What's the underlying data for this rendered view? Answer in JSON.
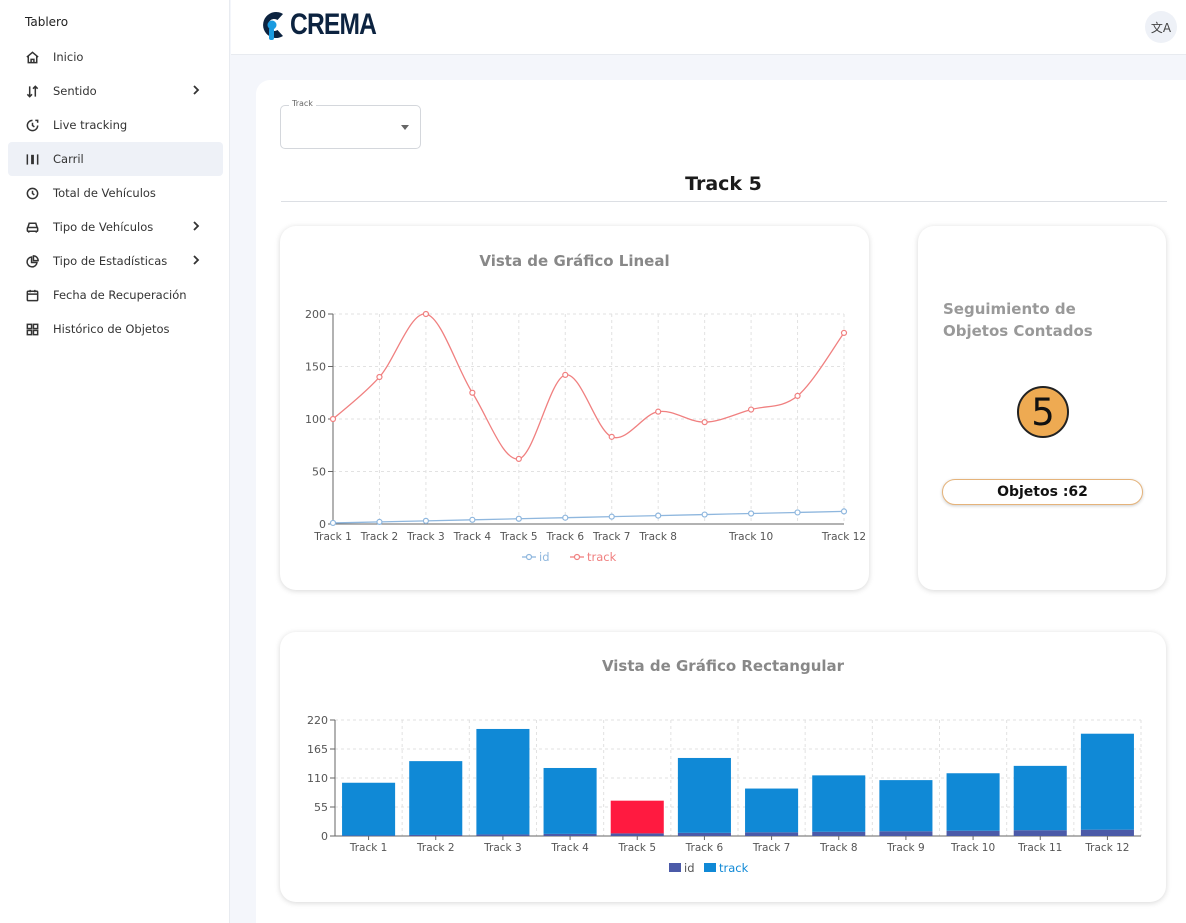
{
  "sidebar": {
    "heading": "Tablero",
    "items": [
      {
        "label": "Inicio",
        "icon": "home-icon",
        "chevron": false,
        "active": false
      },
      {
        "label": "Sentido",
        "icon": "sort-arrows-icon",
        "chevron": true,
        "active": false
      },
      {
        "label": "Live tracking",
        "icon": "live-clock-icon",
        "chevron": false,
        "active": false
      },
      {
        "label": "Carril",
        "icon": "lane-icon",
        "chevron": false,
        "active": true
      },
      {
        "label": "Total de Vehículos",
        "icon": "clock-icon",
        "chevron": false,
        "active": false
      },
      {
        "label": "Tipo de Vehículos",
        "icon": "car-icon",
        "chevron": true,
        "active": false
      },
      {
        "label": "Tipo de Estadísticas",
        "icon": "pie-chart-icon",
        "chevron": true,
        "active": false
      },
      {
        "label": "Fecha de Recuperación",
        "icon": "calendar-icon",
        "chevron": false,
        "active": false
      },
      {
        "label": "Histórico de Objetos",
        "icon": "grid-icon",
        "chevron": false,
        "active": false
      }
    ]
  },
  "header": {
    "logo_text": "CREMA",
    "translate_icon": "translate-icon",
    "translate_glyph": "文A"
  },
  "main": {
    "select_label": "Track",
    "select_value": "",
    "title": "Track 5",
    "count_card": {
      "title": "Seguimiento de Objetos Contados",
      "number": "5",
      "objects_label": "Objetos :62"
    }
  },
  "colors": {
    "line_id": "#8fb7de",
    "line_track": "#f08080",
    "bar_track": "#1089d6",
    "bar_highlight": "#ff1a40",
    "bar_id": "#4b5aa8",
    "badge": "#eeaa52"
  },
  "chart_data": [
    {
      "type": "line",
      "title": "Vista de Gráfico Lineal",
      "categories": [
        "Track 1",
        "Track 2",
        "Track 3",
        "Track 4",
        "Track 5",
        "Track 6",
        "Track 7",
        "Track 8",
        "Track 9",
        "Track 10",
        "Track 11",
        "Track 12"
      ],
      "tick_labels_shown": [
        "Track 1",
        "Track 2",
        "Track 3",
        "Track 4",
        "Track 5",
        "Track 6",
        "Track 7",
        "Track 8",
        "Track 10",
        "Track 12"
      ],
      "series": [
        {
          "name": "id",
          "values": [
            1,
            2,
            3,
            4,
            5,
            6,
            7,
            8,
            9,
            10,
            11,
            12
          ]
        },
        {
          "name": "track",
          "values": [
            100,
            140,
            200,
            125,
            62,
            142,
            83,
            107,
            97,
            109,
            122,
            182
          ]
        }
      ],
      "ylim": [
        0,
        200
      ],
      "yticks": [
        0,
        50,
        100,
        150,
        200
      ],
      "grid": true,
      "legend": "bottom"
    },
    {
      "type": "bar",
      "title": "Vista de Gráfico Rectangular",
      "categories": [
        "Track 1",
        "Track 2",
        "Track 3",
        "Track 4",
        "Track 5",
        "Track 6",
        "Track 7",
        "Track 8",
        "Track 9",
        "Track 10",
        "Track 11",
        "Track 12"
      ],
      "series": [
        {
          "name": "id",
          "values": [
            1,
            2,
            3,
            4,
            5,
            6,
            7,
            8,
            9,
            10,
            11,
            12
          ]
        },
        {
          "name": "track",
          "values": [
            100,
            140,
            200,
            125,
            62,
            142,
            83,
            107,
            97,
            109,
            122,
            182
          ]
        }
      ],
      "stacked": true,
      "highlight": "Track 5",
      "ylim": [
        0,
        220
      ],
      "yticks": [
        0,
        55,
        110,
        165,
        220
      ],
      "grid": true,
      "legend": "bottom"
    }
  ]
}
